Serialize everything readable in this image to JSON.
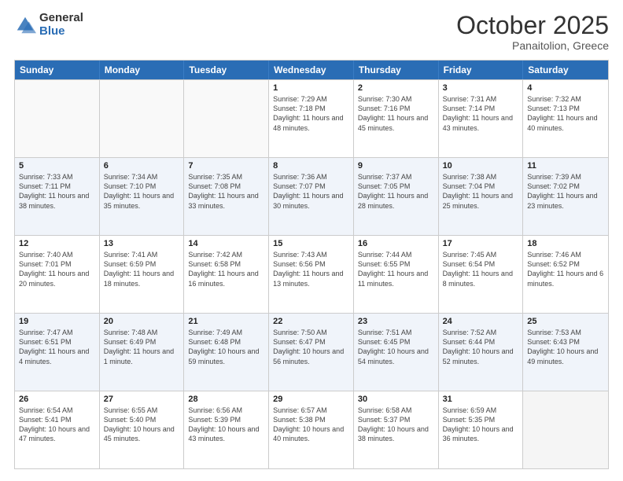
{
  "logo": {
    "general": "General",
    "blue": "Blue"
  },
  "title": "October 2025",
  "location": "Panaitolion, Greece",
  "days": [
    "Sunday",
    "Monday",
    "Tuesday",
    "Wednesday",
    "Thursday",
    "Friday",
    "Saturday"
  ],
  "weeks": [
    [
      {
        "day": "",
        "info": ""
      },
      {
        "day": "",
        "info": ""
      },
      {
        "day": "",
        "info": ""
      },
      {
        "day": "1",
        "info": "Sunrise: 7:29 AM\nSunset: 7:18 PM\nDaylight: 11 hours and 48 minutes."
      },
      {
        "day": "2",
        "info": "Sunrise: 7:30 AM\nSunset: 7:16 PM\nDaylight: 11 hours and 45 minutes."
      },
      {
        "day": "3",
        "info": "Sunrise: 7:31 AM\nSunset: 7:14 PM\nDaylight: 11 hours and 43 minutes."
      },
      {
        "day": "4",
        "info": "Sunrise: 7:32 AM\nSunset: 7:13 PM\nDaylight: 11 hours and 40 minutes."
      }
    ],
    [
      {
        "day": "5",
        "info": "Sunrise: 7:33 AM\nSunset: 7:11 PM\nDaylight: 11 hours and 38 minutes."
      },
      {
        "day": "6",
        "info": "Sunrise: 7:34 AM\nSunset: 7:10 PM\nDaylight: 11 hours and 35 minutes."
      },
      {
        "day": "7",
        "info": "Sunrise: 7:35 AM\nSunset: 7:08 PM\nDaylight: 11 hours and 33 minutes."
      },
      {
        "day": "8",
        "info": "Sunrise: 7:36 AM\nSunset: 7:07 PM\nDaylight: 11 hours and 30 minutes."
      },
      {
        "day": "9",
        "info": "Sunrise: 7:37 AM\nSunset: 7:05 PM\nDaylight: 11 hours and 28 minutes."
      },
      {
        "day": "10",
        "info": "Sunrise: 7:38 AM\nSunset: 7:04 PM\nDaylight: 11 hours and 25 minutes."
      },
      {
        "day": "11",
        "info": "Sunrise: 7:39 AM\nSunset: 7:02 PM\nDaylight: 11 hours and 23 minutes."
      }
    ],
    [
      {
        "day": "12",
        "info": "Sunrise: 7:40 AM\nSunset: 7:01 PM\nDaylight: 11 hours and 20 minutes."
      },
      {
        "day": "13",
        "info": "Sunrise: 7:41 AM\nSunset: 6:59 PM\nDaylight: 11 hours and 18 minutes."
      },
      {
        "day": "14",
        "info": "Sunrise: 7:42 AM\nSunset: 6:58 PM\nDaylight: 11 hours and 16 minutes."
      },
      {
        "day": "15",
        "info": "Sunrise: 7:43 AM\nSunset: 6:56 PM\nDaylight: 11 hours and 13 minutes."
      },
      {
        "day": "16",
        "info": "Sunrise: 7:44 AM\nSunset: 6:55 PM\nDaylight: 11 hours and 11 minutes."
      },
      {
        "day": "17",
        "info": "Sunrise: 7:45 AM\nSunset: 6:54 PM\nDaylight: 11 hours and 8 minutes."
      },
      {
        "day": "18",
        "info": "Sunrise: 7:46 AM\nSunset: 6:52 PM\nDaylight: 11 hours and 6 minutes."
      }
    ],
    [
      {
        "day": "19",
        "info": "Sunrise: 7:47 AM\nSunset: 6:51 PM\nDaylight: 11 hours and 4 minutes."
      },
      {
        "day": "20",
        "info": "Sunrise: 7:48 AM\nSunset: 6:49 PM\nDaylight: 11 hours and 1 minute."
      },
      {
        "day": "21",
        "info": "Sunrise: 7:49 AM\nSunset: 6:48 PM\nDaylight: 10 hours and 59 minutes."
      },
      {
        "day": "22",
        "info": "Sunrise: 7:50 AM\nSunset: 6:47 PM\nDaylight: 10 hours and 56 minutes."
      },
      {
        "day": "23",
        "info": "Sunrise: 7:51 AM\nSunset: 6:45 PM\nDaylight: 10 hours and 54 minutes."
      },
      {
        "day": "24",
        "info": "Sunrise: 7:52 AM\nSunset: 6:44 PM\nDaylight: 10 hours and 52 minutes."
      },
      {
        "day": "25",
        "info": "Sunrise: 7:53 AM\nSunset: 6:43 PM\nDaylight: 10 hours and 49 minutes."
      }
    ],
    [
      {
        "day": "26",
        "info": "Sunrise: 6:54 AM\nSunset: 5:41 PM\nDaylight: 10 hours and 47 minutes."
      },
      {
        "day": "27",
        "info": "Sunrise: 6:55 AM\nSunset: 5:40 PM\nDaylight: 10 hours and 45 minutes."
      },
      {
        "day": "28",
        "info": "Sunrise: 6:56 AM\nSunset: 5:39 PM\nDaylight: 10 hours and 43 minutes."
      },
      {
        "day": "29",
        "info": "Sunrise: 6:57 AM\nSunset: 5:38 PM\nDaylight: 10 hours and 40 minutes."
      },
      {
        "day": "30",
        "info": "Sunrise: 6:58 AM\nSunset: 5:37 PM\nDaylight: 10 hours and 38 minutes."
      },
      {
        "day": "31",
        "info": "Sunrise: 6:59 AM\nSunset: 5:35 PM\nDaylight: 10 hours and 36 minutes."
      },
      {
        "day": "",
        "info": ""
      }
    ]
  ]
}
